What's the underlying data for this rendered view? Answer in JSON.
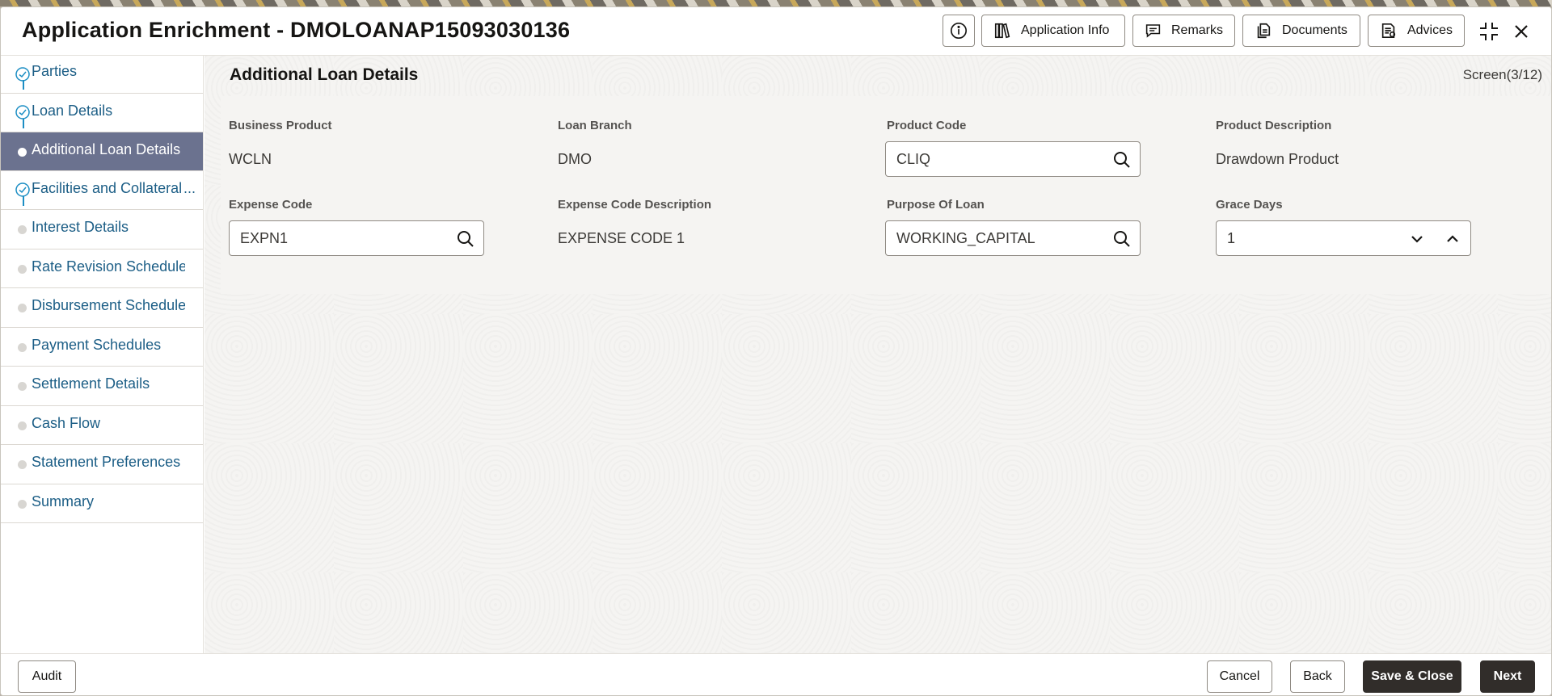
{
  "window": {
    "title": "Application Enrichment - DMOLOANAP15093030136"
  },
  "header": {
    "buttons": [
      {
        "label": "Application Info",
        "icon": "books-icon"
      },
      {
        "label": "Remarks",
        "icon": "message-icon"
      },
      {
        "label": "Documents",
        "icon": "documents-icon"
      },
      {
        "label": "Advices",
        "icon": "advices-icon"
      }
    ]
  },
  "sidebar": {
    "items": [
      {
        "label": "Parties",
        "state": "completed"
      },
      {
        "label": "Loan Details",
        "state": "completed"
      },
      {
        "label": "Additional Loan Details",
        "state": "active"
      },
      {
        "label": "Facilities and Collateral",
        "state": "completed"
      },
      {
        "label": "Interest Details",
        "state": "pending"
      },
      {
        "label": "Rate Revision Schedules",
        "state": "pending"
      },
      {
        "label": "Disbursement Schedules",
        "state": "pending"
      },
      {
        "label": "Payment Schedules",
        "state": "pending"
      },
      {
        "label": "Settlement Details",
        "state": "pending"
      },
      {
        "label": "Cash Flow",
        "state": "pending"
      },
      {
        "label": "Statement Preferences",
        "state": "pending"
      },
      {
        "label": "Summary",
        "state": "pending"
      }
    ],
    "ellipsis": "..."
  },
  "main": {
    "section_title": "Additional Loan Details",
    "screen_count": "Screen(3/12)",
    "fields": {
      "business_product": {
        "label": "Business Product",
        "value": "WCLN"
      },
      "loan_branch": {
        "label": "Loan Branch",
        "value": "DMO"
      },
      "product_code": {
        "label": "Product Code",
        "value": "CLIQ"
      },
      "product_description": {
        "label": "Product Description",
        "value": "Drawdown Product"
      },
      "expense_code": {
        "label": "Expense Code",
        "value": "EXPN1"
      },
      "expense_code_description": {
        "label": "Expense Code Description",
        "value": "EXPENSE CODE 1"
      },
      "purpose_of_loan": {
        "label": "Purpose Of Loan",
        "value": "WORKING_CAPITAL"
      },
      "grace_days": {
        "label": "Grace Days",
        "value": "1"
      }
    }
  },
  "footer": {
    "audit": "Audit",
    "cancel": "Cancel",
    "back": "Back",
    "save_close": "Save & Close",
    "next": "Next"
  },
  "colors": {
    "active_nav": "#6b728f",
    "nav_link": "#1c5e86",
    "step_line": "#1c8ec4",
    "primary_button": "#312d2a"
  }
}
